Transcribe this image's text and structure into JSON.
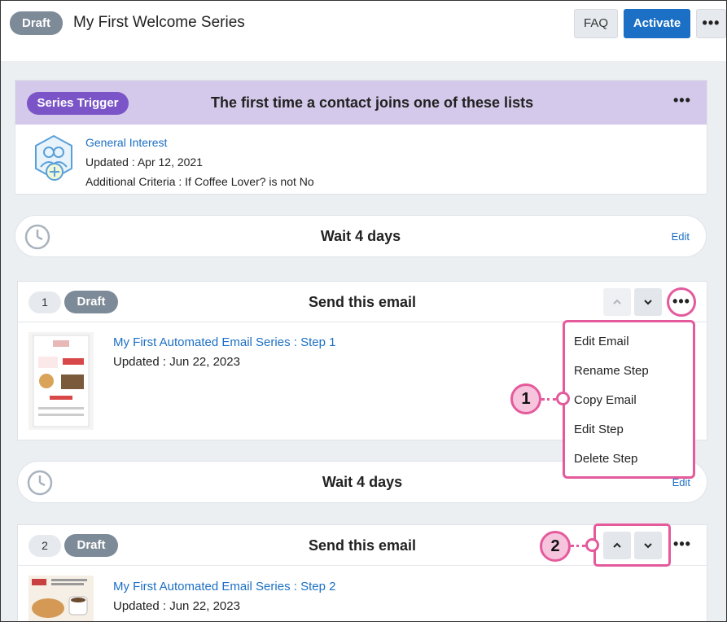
{
  "header": {
    "status": "Draft",
    "title": "My First Welcome Series",
    "faq_label": "FAQ",
    "activate_label": "Activate",
    "more_icon": "more-horizontal-icon",
    "accent_color": "#1b6fc4"
  },
  "trigger": {
    "pill_label": "Series Trigger",
    "title": "The first time a contact joins one of these lists",
    "list_name": "General Interest",
    "updated": "Updated : Apr 12, 2021",
    "criteria": "Additional Criteria : If Coffee Lover? is not No",
    "pill_color": "#7b55c7",
    "header_color": "#d4c9ea"
  },
  "waits": [
    {
      "label": "Wait 4 days",
      "edit_label": "Edit"
    },
    {
      "label": "Wait 4 days",
      "edit_label": "Edit"
    }
  ],
  "steps": [
    {
      "number": "1",
      "status": "Draft",
      "title": "Send this email",
      "email_name": "My First Automated Email Series : Step 1",
      "updated": "Updated : Jun 22, 2023"
    },
    {
      "number": "2",
      "status": "Draft",
      "title": "Send this email",
      "email_name": "My First Automated Email Series : Step 2",
      "updated": "Updated : Jun 22, 2023"
    }
  ],
  "menu": {
    "items": [
      "Edit Email",
      "Rename Step",
      "Copy Email",
      "Edit Step",
      "Delete Step"
    ]
  },
  "callouts": {
    "one": "1",
    "two": "2",
    "highlight_color": "#e45a9c"
  }
}
